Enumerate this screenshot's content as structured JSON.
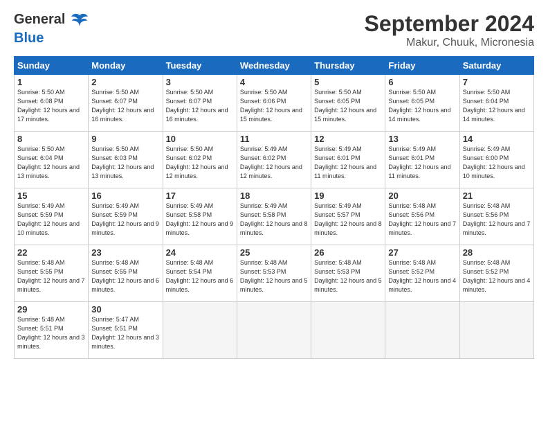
{
  "header": {
    "logo_line1": "General",
    "logo_line2": "Blue",
    "month": "September 2024",
    "location": "Makur, Chuuk, Micronesia"
  },
  "days_of_week": [
    "Sunday",
    "Monday",
    "Tuesday",
    "Wednesday",
    "Thursday",
    "Friday",
    "Saturday"
  ],
  "weeks": [
    [
      {
        "num": "1",
        "sunrise": "5:50 AM",
        "sunset": "6:08 PM",
        "daylight": "12 hours and 17 minutes."
      },
      {
        "num": "2",
        "sunrise": "5:50 AM",
        "sunset": "6:07 PM",
        "daylight": "12 hours and 16 minutes."
      },
      {
        "num": "3",
        "sunrise": "5:50 AM",
        "sunset": "6:07 PM",
        "daylight": "12 hours and 16 minutes."
      },
      {
        "num": "4",
        "sunrise": "5:50 AM",
        "sunset": "6:06 PM",
        "daylight": "12 hours and 15 minutes."
      },
      {
        "num": "5",
        "sunrise": "5:50 AM",
        "sunset": "6:05 PM",
        "daylight": "12 hours and 15 minutes."
      },
      {
        "num": "6",
        "sunrise": "5:50 AM",
        "sunset": "6:05 PM",
        "daylight": "12 hours and 14 minutes."
      },
      {
        "num": "7",
        "sunrise": "5:50 AM",
        "sunset": "6:04 PM",
        "daylight": "12 hours and 14 minutes."
      }
    ],
    [
      {
        "num": "8",
        "sunrise": "5:50 AM",
        "sunset": "6:04 PM",
        "daylight": "12 hours and 13 minutes."
      },
      {
        "num": "9",
        "sunrise": "5:50 AM",
        "sunset": "6:03 PM",
        "daylight": "12 hours and 13 minutes."
      },
      {
        "num": "10",
        "sunrise": "5:50 AM",
        "sunset": "6:02 PM",
        "daylight": "12 hours and 12 minutes."
      },
      {
        "num": "11",
        "sunrise": "5:49 AM",
        "sunset": "6:02 PM",
        "daylight": "12 hours and 12 minutes."
      },
      {
        "num": "12",
        "sunrise": "5:49 AM",
        "sunset": "6:01 PM",
        "daylight": "12 hours and 11 minutes."
      },
      {
        "num": "13",
        "sunrise": "5:49 AM",
        "sunset": "6:01 PM",
        "daylight": "12 hours and 11 minutes."
      },
      {
        "num": "14",
        "sunrise": "5:49 AM",
        "sunset": "6:00 PM",
        "daylight": "12 hours and 10 minutes."
      }
    ],
    [
      {
        "num": "15",
        "sunrise": "5:49 AM",
        "sunset": "5:59 PM",
        "daylight": "12 hours and 10 minutes."
      },
      {
        "num": "16",
        "sunrise": "5:49 AM",
        "sunset": "5:59 PM",
        "daylight": "12 hours and 9 minutes."
      },
      {
        "num": "17",
        "sunrise": "5:49 AM",
        "sunset": "5:58 PM",
        "daylight": "12 hours and 9 minutes."
      },
      {
        "num": "18",
        "sunrise": "5:49 AM",
        "sunset": "5:58 PM",
        "daylight": "12 hours and 8 minutes."
      },
      {
        "num": "19",
        "sunrise": "5:49 AM",
        "sunset": "5:57 PM",
        "daylight": "12 hours and 8 minutes."
      },
      {
        "num": "20",
        "sunrise": "5:48 AM",
        "sunset": "5:56 PM",
        "daylight": "12 hours and 7 minutes."
      },
      {
        "num": "21",
        "sunrise": "5:48 AM",
        "sunset": "5:56 PM",
        "daylight": "12 hours and 7 minutes."
      }
    ],
    [
      {
        "num": "22",
        "sunrise": "5:48 AM",
        "sunset": "5:55 PM",
        "daylight": "12 hours and 7 minutes."
      },
      {
        "num": "23",
        "sunrise": "5:48 AM",
        "sunset": "5:55 PM",
        "daylight": "12 hours and 6 minutes."
      },
      {
        "num": "24",
        "sunrise": "5:48 AM",
        "sunset": "5:54 PM",
        "daylight": "12 hours and 6 minutes."
      },
      {
        "num": "25",
        "sunrise": "5:48 AM",
        "sunset": "5:53 PM",
        "daylight": "12 hours and 5 minutes."
      },
      {
        "num": "26",
        "sunrise": "5:48 AM",
        "sunset": "5:53 PM",
        "daylight": "12 hours and 5 minutes."
      },
      {
        "num": "27",
        "sunrise": "5:48 AM",
        "sunset": "5:52 PM",
        "daylight": "12 hours and 4 minutes."
      },
      {
        "num": "28",
        "sunrise": "5:48 AM",
        "sunset": "5:52 PM",
        "daylight": "12 hours and 4 minutes."
      }
    ],
    [
      {
        "num": "29",
        "sunrise": "5:48 AM",
        "sunset": "5:51 PM",
        "daylight": "12 hours and 3 minutes."
      },
      {
        "num": "30",
        "sunrise": "5:47 AM",
        "sunset": "5:51 PM",
        "daylight": "12 hours and 3 minutes."
      },
      null,
      null,
      null,
      null,
      null
    ]
  ]
}
